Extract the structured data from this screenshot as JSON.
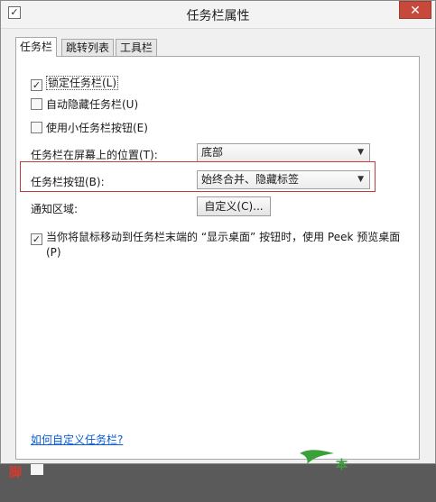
{
  "window": {
    "title": "任务栏属性",
    "close_glyph": "✕",
    "icon_glyph": "✓"
  },
  "tabs": [
    {
      "label": "任务栏",
      "active": true
    },
    {
      "label": "跳转列表",
      "active": false
    },
    {
      "label": "工具栏",
      "active": false
    }
  ],
  "checkboxes": {
    "lock": {
      "label": "锁定任务栏(L)",
      "checked": true
    },
    "autohide": {
      "label": "自动隐藏任务栏(U)",
      "checked": false
    },
    "small": {
      "label": "使用小任务栏按钮(E)",
      "checked": false
    },
    "peek": {
      "label": "当你将鼠标移动到任务栏末端的 “显示桌面” 按钮时，使用 Peek 预览桌面",
      "label2": "(P)",
      "checked": true
    }
  },
  "settings": {
    "position_label": "任务栏在屏幕上的位置(T):",
    "position_value": "底部",
    "buttons_label": "任务栏按钮(B):",
    "buttons_value": "始终合并、隐藏标签",
    "notify_label": "通知区域:",
    "customize_button": "自定义(C)..."
  },
  "link": "如何自定义任务栏?",
  "watermark": {
    "left_text": "脚",
    "logo_text": "本"
  },
  "colors": {
    "highlight": "#c53a3a",
    "link": "#0a5bd6",
    "close": "#c7493b"
  }
}
